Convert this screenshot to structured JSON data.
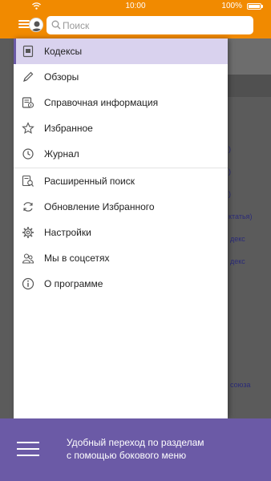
{
  "status_bar": {
    "time": "10:00",
    "battery_text": "100%"
  },
  "header": {
    "search_placeholder": "Поиск"
  },
  "menu": {
    "items": [
      {
        "label": "Кодексы",
        "icon": "codex-icon",
        "active": true
      },
      {
        "label": "Обзоры",
        "icon": "pen-icon"
      },
      {
        "label": "Справочная информация",
        "icon": "reference-icon"
      },
      {
        "label": "Избранное",
        "icon": "star-icon"
      },
      {
        "label": "Журнал",
        "icon": "clock-icon"
      },
      {
        "label": "Расширенный поиск",
        "icon": "advanced-search-icon"
      },
      {
        "label": "Обновление Избранного",
        "icon": "refresh-icon"
      },
      {
        "label": "Настройки",
        "icon": "gear-icon"
      },
      {
        "label": "Мы в соцсетях",
        "icon": "people-icon"
      },
      {
        "label": "О программе",
        "icon": "info-icon"
      }
    ]
  },
  "background_snippets": [
    ")",
    ")",
    ")",
    "ктатья)",
    "декс",
    "декс",
    "союза"
  ],
  "banner": {
    "line1": "Удобный переход по разделам",
    "line2": "с помощью бокового меню"
  },
  "colors": {
    "accent_orange": "#f18a00",
    "purple": "#6b5aa6",
    "active_bg": "#d9d2ee"
  }
}
